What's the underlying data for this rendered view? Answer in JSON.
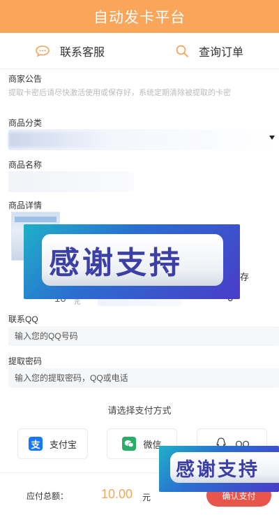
{
  "header": {
    "title": "自动发卡平台"
  },
  "nav": {
    "contact": "联系客服",
    "query": "查询订单"
  },
  "notice": {
    "label": "商家公告",
    "text": "提取卡密后请尽快激活使用或保存好，系统定期清除被提取的卡密"
  },
  "category": {
    "label": "商品分类"
  },
  "product_name": {
    "label": "商品名称"
  },
  "detail": {
    "label": "商品详情",
    "price": "10",
    "price_unit": "元",
    "stock_label": "存",
    "stock_value": "0"
  },
  "qq": {
    "label": "联系QQ",
    "placeholder": "输入您的QQ号码"
  },
  "password": {
    "label": "提取密码",
    "placeholder": "输入您的提取密码，QQ或电话"
  },
  "payment": {
    "title": "请选择支付方式",
    "methods": [
      {
        "label": "支付宝",
        "icon": "alipay-icon",
        "color": "#1677ff"
      },
      {
        "label": "微信",
        "icon": "wechat-icon",
        "color": "#2aae67"
      },
      {
        "label": "QQ",
        "icon": "qq-icon",
        "color": "#222222"
      }
    ]
  },
  "footer": {
    "total_label": "应付总额：",
    "total_value": "10.00",
    "total_unit": "元",
    "confirm": "确认支付"
  },
  "overlay": {
    "text_large": "感谢支持",
    "text_small": "感谢支持"
  },
  "colors": {
    "accent": "#f9a55a",
    "confirm": "#e8554a"
  }
}
